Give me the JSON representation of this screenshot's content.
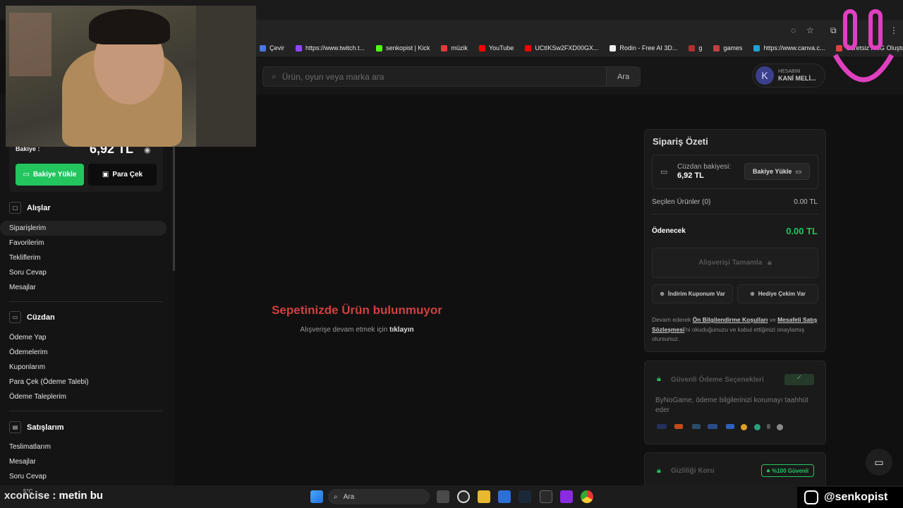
{
  "bookmarks": [
    {
      "label": "Çevir",
      "color": "#4a78e0"
    },
    {
      "label": "https://www.twitch.t...",
      "color": "#9146ff"
    },
    {
      "label": "senkopist | Kick",
      "color": "#53fc18"
    },
    {
      "label": "müzik",
      "color": "#e03a3a"
    },
    {
      "label": "YouTube",
      "color": "#ff0000"
    },
    {
      "label": "UCtIKSw2FXD00GX...",
      "color": "#ff0000"
    },
    {
      "label": "Rodin - Free AI 3D...",
      "color": "#eeeeee"
    },
    {
      "label": "g",
      "color": "#b03030"
    },
    {
      "label": "games",
      "color": "#c04040"
    },
    {
      "label": "https://www.canva.c...",
      "color": "#1fa2d9"
    },
    {
      "label": "Ücretsiz PNG Oluştu...",
      "color": "#e04040"
    }
  ],
  "search": {
    "placeholder": "Ürün, oyun veya marka ara",
    "button": "Ara"
  },
  "account": {
    "avatar": "K",
    "title": "HESABIM",
    "name": "KANİ MELİ..."
  },
  "sidebar": {
    "balance_label": "Bakiye :",
    "balance_value": "6,92 TL",
    "load_button": "Bakiye Yükle",
    "withdraw_button": "Para Çek",
    "purchases": {
      "title": "Alışlar",
      "items": [
        "Siparişlerim",
        "Favorilerim",
        "Tekliflerim",
        "Soru Cevap",
        "Mesajlar"
      ]
    },
    "wallet": {
      "title": "Cüzdan",
      "items": [
        "Ödeme Yap",
        "Ödemelerim",
        "Kuponlarım",
        "Para Çek (Ödeme Talebi)",
        "Ödeme Taleplerim"
      ]
    },
    "sales": {
      "title": "Satışlarım",
      "items": [
        "Teslimatlarım",
        "Mesajlar",
        "Soru Cevap"
      ]
    }
  },
  "cart": {
    "empty_title": "Sepetinizde Ürün bulunmuyor",
    "empty_sub_prefix": "Alışverişe devam etmek için ",
    "empty_sub_link": "tıklayın"
  },
  "summary": {
    "title": "Sipariş Özeti",
    "wallet_label": "Cüzdan bakiyesi:",
    "wallet_value": "6,92 TL",
    "wallet_button": "Bakiye Yükle",
    "selected_label": "Seçilen Ürünler (0)",
    "selected_value": "0.00 TL",
    "due_label": "Ödenecek",
    "due_value": "0.00 TL",
    "checkout_button": "Alışverişi Tamamla",
    "coupon_button": "İndirim Kuponum Var",
    "gift_button": "Hediye Çekim Var",
    "terms_1": "Devam ederek ",
    "terms_link1": "Ön Bilgilendirme Koşulları",
    "terms_2": " ve ",
    "terms_link2": "Mesafeli Satış Sözleşmesi",
    "terms_3": "'ni okuduğunuzu ve kabul ettiğinizi onaylamış olursunuz."
  },
  "secure": {
    "title": "Güvenli Ödeme Seçenekleri",
    "text": "ByNoGame, ödeme bilgilerinizi korumayı taahhüt eder"
  },
  "privacy": {
    "title": "Gizliliği Koru",
    "badge": "%100 Güvenli"
  },
  "taskbar": {
    "search": "Ara",
    "weather": "5°C"
  },
  "overlay": {
    "user": "xconcise",
    "message": " : metin bu",
    "instagram": "@senkopist"
  },
  "colors": {
    "accent_green": "#22c55e",
    "error_red": "#d04040"
  }
}
